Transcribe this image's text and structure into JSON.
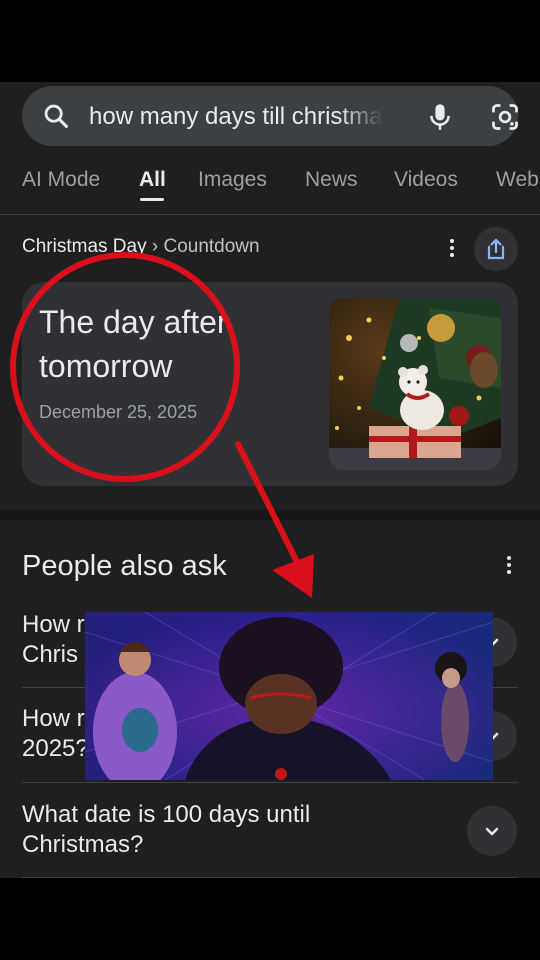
{
  "search": {
    "query": "how many days till christmas"
  },
  "tabs": [
    {
      "label": "AI Mode"
    },
    {
      "label": "All"
    },
    {
      "label": "Images"
    },
    {
      "label": "News"
    },
    {
      "label": "Videos"
    },
    {
      "label": "Web"
    }
  ],
  "breadcrumb": {
    "title": "Christmas Day",
    "separator": "›",
    "sub": "Countdown"
  },
  "card": {
    "headline_line1": "The day after",
    "headline_line2": "tomorrow",
    "date": "December 25, 2025"
  },
  "paa": {
    "title": "People also ask",
    "questions": [
      {
        "text_line1": "How r",
        "text_line2": "Chris"
      },
      {
        "text_line1": "How r",
        "text_line2": "2025?"
      },
      {
        "text_line1": "What date is 100 days until",
        "text_line2": "Christmas?"
      }
    ]
  },
  "colors": {
    "background": "#1f1f1f",
    "surface": "#303134",
    "annotation_red": "#d9101c"
  },
  "icons": [
    "search-icon",
    "mic-icon",
    "lens-icon",
    "more-vert-icon",
    "share-icon",
    "chevron-down-icon"
  ]
}
